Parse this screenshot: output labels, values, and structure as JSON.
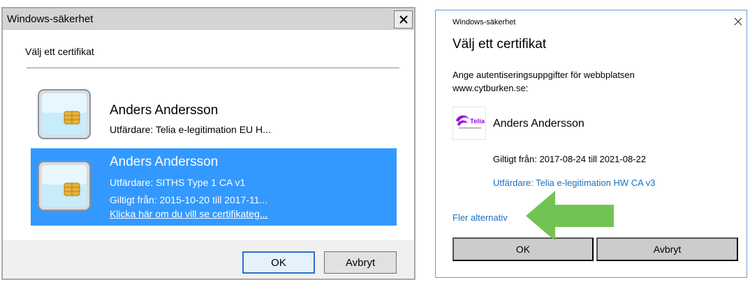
{
  "left_dialog": {
    "title": "Windows-säkerhet",
    "heading": "Välj ett certifikat",
    "certificates": [
      {
        "name": "Anders Andersson",
        "issuer": "Utfärdare: Telia e-legitimation EU H...",
        "selected": false
      },
      {
        "name": "Anders Andersson",
        "issuer": "Utfärdare: SITHS Type 1 CA v1",
        "valid": "Giltigt från: 2015-10-20 till 2017-11...",
        "link": "Klicka här om du vill se certifikateg...",
        "selected": true
      }
    ],
    "ok_label": "OK",
    "cancel_label": "Avbryt"
  },
  "right_dialog": {
    "title": "Windows-säkerhet",
    "heading": "Välj ett certifikat",
    "description": "Ange autentiseringsuppgifter för webbplatsen www.cytburken.se:",
    "logo_text": "Telia",
    "cert_name": "Anders Andersson",
    "valid": "Giltigt från: 2017-08-24 till 2021-08-22",
    "issuer": "Utfärdare: Telia e-legitimation HW CA v3",
    "more_options": "Fler alternativ",
    "ok_label": "OK",
    "cancel_label": "Avbryt"
  },
  "colors": {
    "selection": "#3399ff",
    "link": "#1a6fc4",
    "arrow": "#6cc04a",
    "telia_purple": "#990ae3"
  }
}
